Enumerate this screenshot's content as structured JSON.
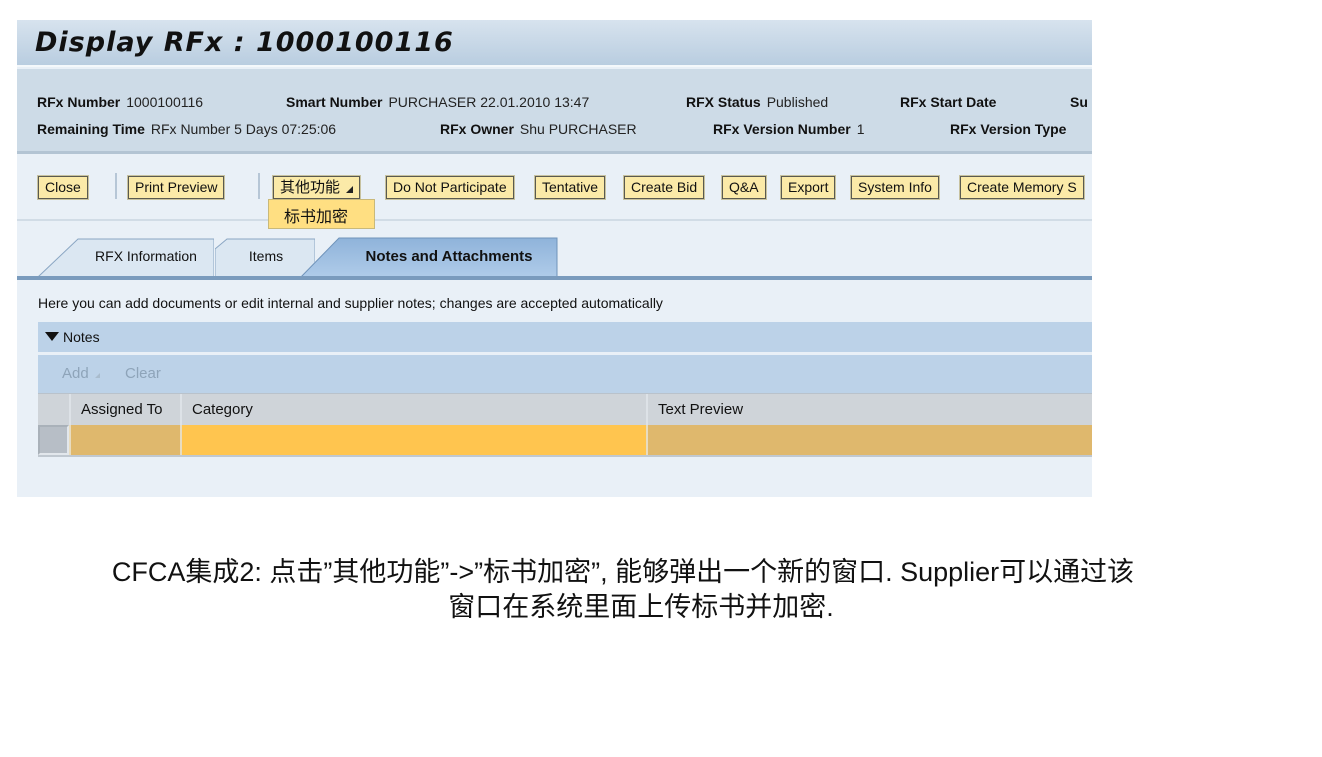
{
  "window": {
    "title": "Display RFx : 1000100116"
  },
  "header": {
    "row1": [
      {
        "label": "RFx Number",
        "value": "1000100116"
      },
      {
        "label": "Smart Number",
        "value": "PURCHASER 22.01.2010 13:47"
      },
      {
        "label": "RFX Status",
        "value": "Published"
      },
      {
        "label": "RFx Start Date",
        "value": ""
      },
      {
        "label": "Su",
        "value": ""
      }
    ],
    "row2": [
      {
        "label": "Remaining Time",
        "value": "RFx Number 5 Days 07:25:06"
      },
      {
        "label": "RFx Owner",
        "value": "Shu PURCHASER"
      },
      {
        "label": "RFx Version Number",
        "value": "1"
      },
      {
        "label": "RFx Version Type",
        "value": ""
      }
    ]
  },
  "toolbar": {
    "close": "Close",
    "print_preview": "Print Preview",
    "more_functions": "其他功能",
    "do_not_participate": "Do Not Participate",
    "tentative": "Tentative",
    "create_bid": "Create Bid",
    "qa": "Q&A",
    "export": "Export",
    "system_info": "System Info",
    "create_memory": "Create Memory S"
  },
  "dropdown_menu": {
    "items": [
      "标书加密"
    ]
  },
  "tabs": [
    {
      "label": "RFX Information",
      "active": false
    },
    {
      "label": "Items",
      "active": false
    },
    {
      "label": "Notes and Attachments",
      "active": true
    }
  ],
  "content": {
    "info_text": "Here you can add documents or edit internal and supplier notes; changes are accepted automatically",
    "notes_section": {
      "title": "Notes",
      "expanded": true,
      "toolbar": {
        "add": "Add",
        "clear": "Clear"
      },
      "columns": [
        "Assigned To",
        "Category",
        "Text Preview"
      ],
      "rows": [
        {
          "assigned_to": "",
          "category": "",
          "text_preview": ""
        }
      ]
    }
  },
  "colors": {
    "button_bg": "#fbeaa8",
    "menu_bg": "#ffdf82",
    "row_cell_a": "#dfb86d",
    "row_cell_b": "#ffc54f",
    "tab_active": "#a9c6e6",
    "section_bg": "#bcd2e8"
  },
  "caption": {
    "line1": "CFCA集成2: 点击”其他功能”->”标书加密”, 能够弹出一个新的窗口. Supplier可以通过该",
    "line2": "窗口在系统里面上传标书并加密."
  }
}
